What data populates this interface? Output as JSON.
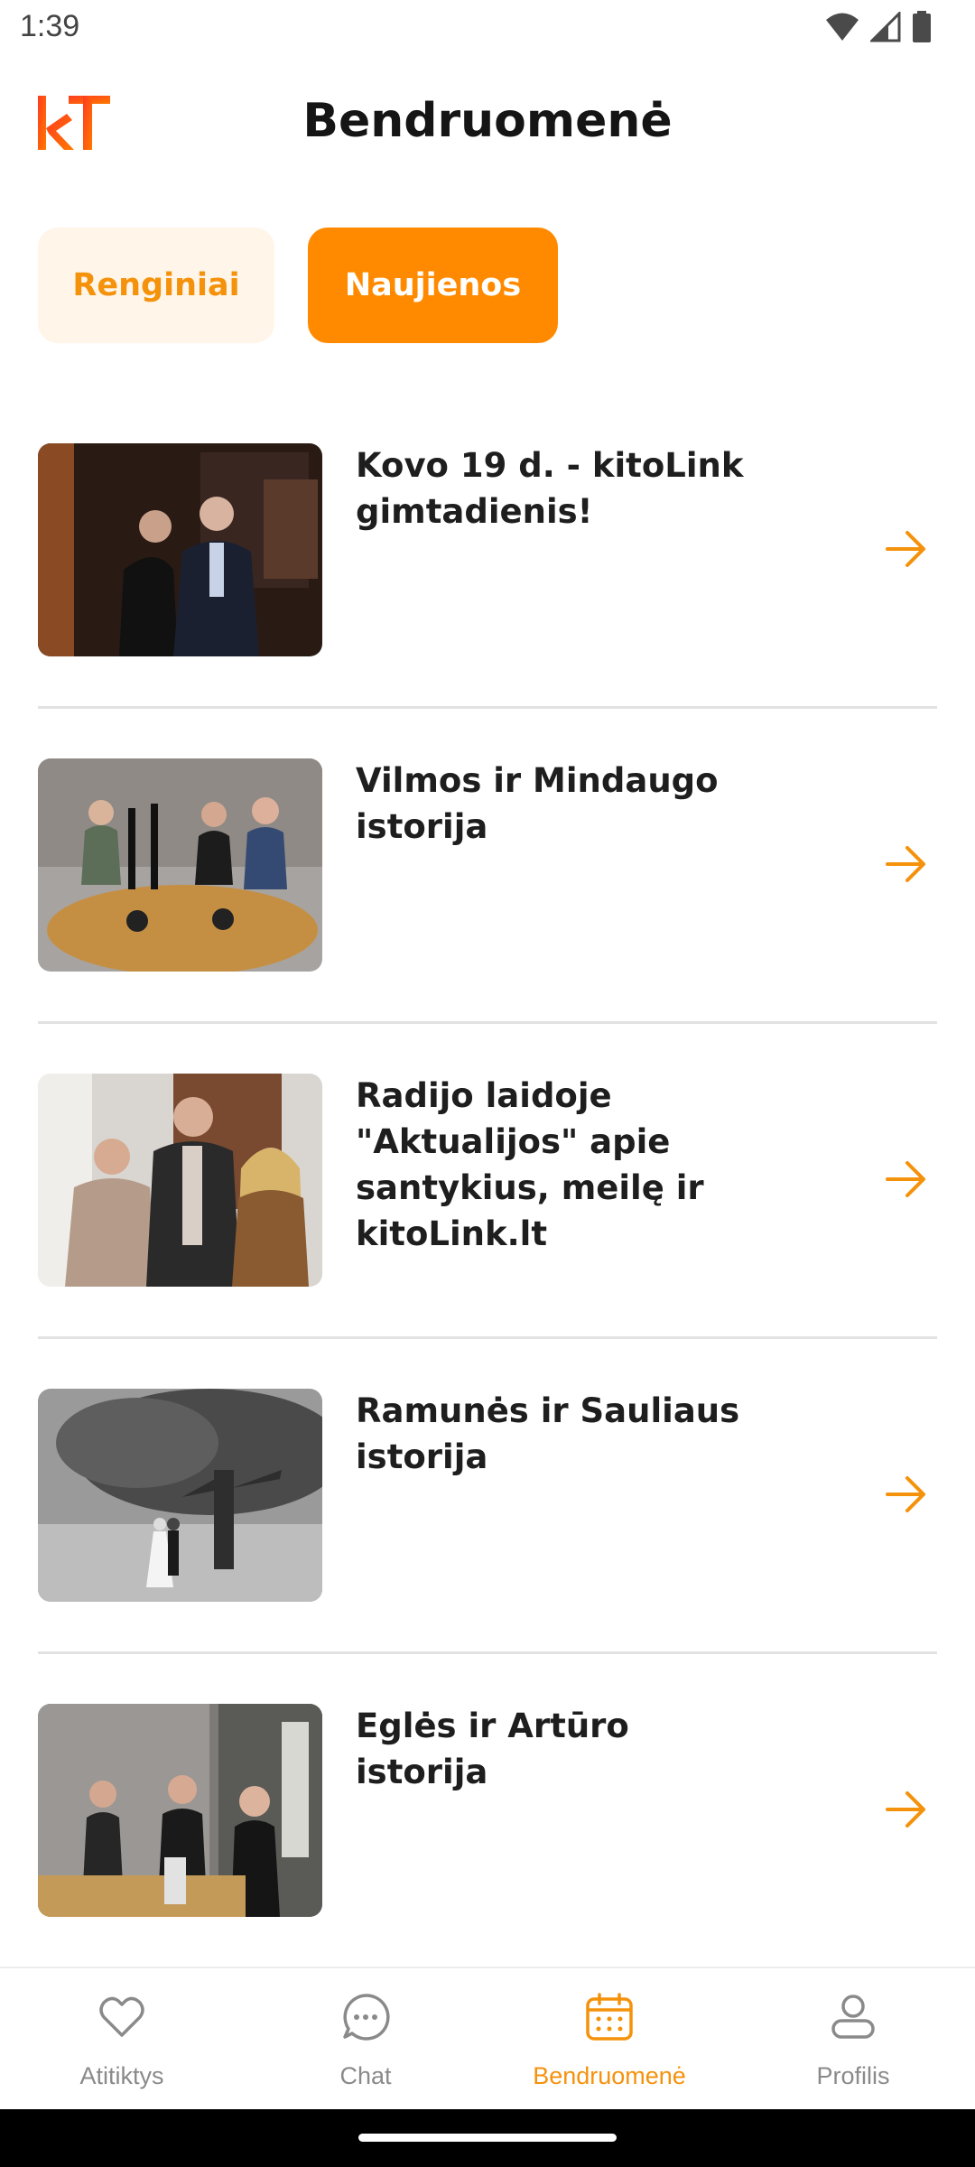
{
  "status_bar": {
    "time": "1:39",
    "icons": [
      "wifi-icon",
      "signal-icon",
      "battery-icon"
    ]
  },
  "header": {
    "logo": "kT",
    "title": "Bendruomenė"
  },
  "tabs": [
    {
      "label": "Renginiai",
      "active": false
    },
    {
      "label": "Naujienos",
      "active": true
    }
  ],
  "news": [
    {
      "title": "Kovo 19 d. - kitoLink gimtadienis!",
      "image": "couple-portrait-photo"
    },
    {
      "title": "Vilmos ir Mindaugo istorija",
      "image": "podcast-studio-photo"
    },
    {
      "title": "Radijo laidoje \"Aktualijos\" apie santykius, meilę ir kitoLink.lt",
      "image": "three-people-hearts-photo"
    },
    {
      "title": "Ramunės ir Sauliaus istorija",
      "image": "wedding-tree-photo"
    },
    {
      "title": "Eglės ir Artūro istorija",
      "image": "radio-studio-photo"
    }
  ],
  "bottom_nav": [
    {
      "label": "Atitiktys",
      "icon": "heart-icon",
      "active": false
    },
    {
      "label": "Chat",
      "icon": "chat-icon",
      "active": false
    },
    {
      "label": "Bendruomenė",
      "icon": "calendar-icon",
      "active": true
    },
    {
      "label": "Profilis",
      "icon": "profile-icon",
      "active": false
    }
  ],
  "colors": {
    "accent": "#ff8a00",
    "accent_text": "#f5920c",
    "tab_inactive_bg": "#fff5e8",
    "inactive_nav": "#8a8a8a"
  }
}
